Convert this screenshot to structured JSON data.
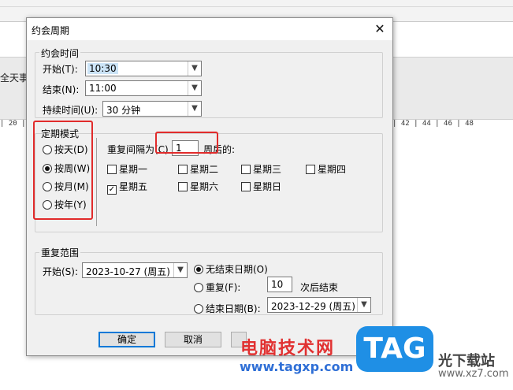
{
  "background": {
    "all_day_label": "全天事",
    "ruler_left": "| 20 |",
    "ruler_right": "| 42 | 44 | 46 | 48"
  },
  "dialog": {
    "title": "约会周期",
    "close_glyph": "✕",
    "appointment_time": {
      "group_label": "约会时间",
      "start_label": "开始(T):",
      "start_value": "10:30",
      "end_label": "结束(N):",
      "end_value": "11:00",
      "duration_label": "持续时间(U):",
      "duration_value": "30 分钟"
    },
    "recurrence_pattern": {
      "group_label": "定期模式",
      "options": [
        {
          "label": "按天(D)",
          "selected": false
        },
        {
          "label": "按周(W)",
          "selected": true
        },
        {
          "label": "按月(M)",
          "selected": false
        },
        {
          "label": "按年(Y)",
          "selected": false
        }
      ],
      "interval_prefix": "重复间隔为(C)",
      "interval_value": "1",
      "interval_suffix": "周后的:",
      "weekdays": [
        {
          "label": "星期一",
          "checked": false
        },
        {
          "label": "星期二",
          "checked": false
        },
        {
          "label": "星期三",
          "checked": false
        },
        {
          "label": "星期四",
          "checked": false
        },
        {
          "label": "星期五",
          "checked": true
        },
        {
          "label": "星期六",
          "checked": false
        },
        {
          "label": "星期日",
          "checked": false
        }
      ]
    },
    "recurrence_range": {
      "group_label": "重复范围",
      "start_label": "开始(S):",
      "start_value": "2023-10-27 (周五)",
      "no_end_label": "无结束日期(O)",
      "repeat_label": "重复(F):",
      "repeat_count": "10",
      "repeat_suffix": "次后结束",
      "end_date_label": "结束日期(B):",
      "end_date_value": "2023-12-29 (周五)",
      "selected": "no_end"
    },
    "buttons": {
      "ok": "确定",
      "cancel": "取消"
    }
  },
  "watermark": {
    "site_name": "电脑技术网",
    "url": "www.tagxp.com",
    "logo_text": "TAG",
    "partner_name": "光下载站",
    "partner_url": "www.xz7.com"
  },
  "colors": {
    "highlight_box": "#e12b2b",
    "default_button_border": "#0078d7",
    "watermark_red": "#e13131",
    "watermark_blue": "#2f6fd6",
    "tag_logo": "#1f8fe5"
  }
}
